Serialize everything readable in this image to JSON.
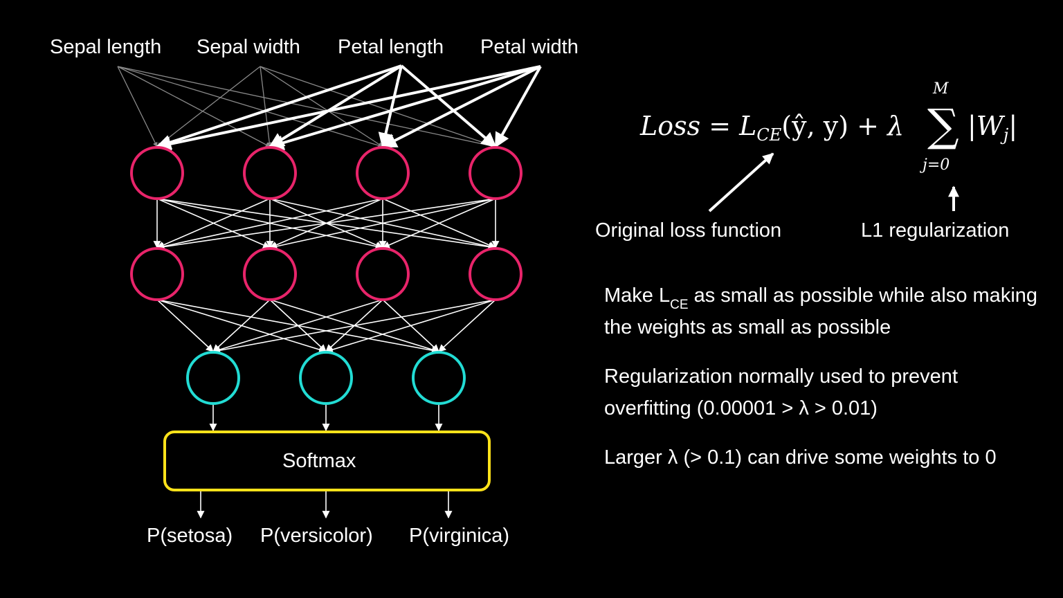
{
  "inputs": [
    {
      "label": "Sepal length",
      "weight": "weak"
    },
    {
      "label": "Sepal width",
      "weight": "weak"
    },
    {
      "label": "Petal length",
      "weight": "strong"
    },
    {
      "label": "Petal width",
      "weight": "strong"
    }
  ],
  "hidden_layers": [
    {
      "units": 4
    },
    {
      "units": 4
    }
  ],
  "output_layer": {
    "units": 3
  },
  "softmax": {
    "label": "Softmax"
  },
  "outputs": [
    "P(setosa)",
    "P(versicolor)",
    "P(virginica)"
  ],
  "colors": {
    "background": "#000000",
    "hidden_node": "#E8246A",
    "output_node": "#22DCD4",
    "softmax_box": "#FFE21A",
    "weak_edge": "#8A8A8A",
    "edge": "#FFFFFF"
  },
  "formula": {
    "lhs": "Loss",
    "equals": "=",
    "ce_symbol": "L",
    "ce_subscript": "CE",
    "ce_args": "(ŷ, y)",
    "plus": "+",
    "lambda": "λ",
    "sum_symbol": "∑",
    "sum_upper": "M",
    "sum_lower": "j=0",
    "abs_term": "|W",
    "abs_subscript": "j",
    "abs_close": "|"
  },
  "annotations": {
    "original_loss": "Original loss function",
    "l1": "L1 regularization"
  },
  "bullets": [
    {
      "pre": "Make L",
      "sub": "CE",
      "post": " as small as possible while also making the weights as small as possible"
    },
    {
      "text": "Regularization normally used to prevent overfitting (0.00001 > λ > 0.01)"
    },
    {
      "text": "Larger λ (> 0.1) can drive some weights to 0"
    }
  ]
}
